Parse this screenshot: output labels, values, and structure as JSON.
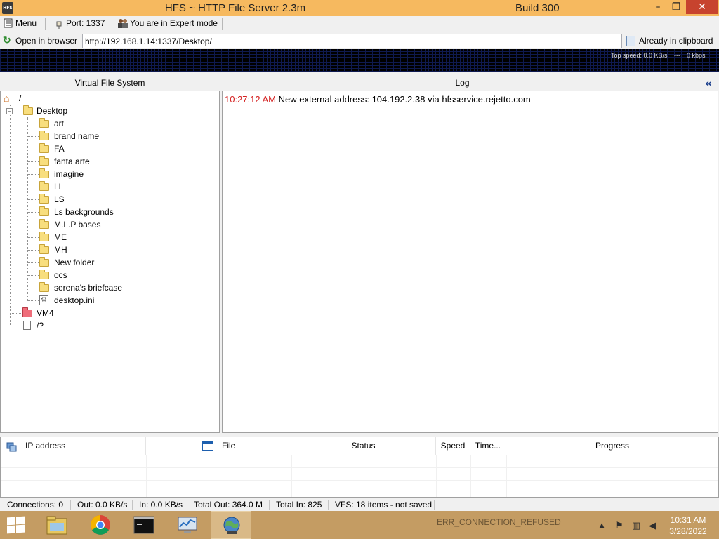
{
  "window": {
    "title": "HFS ~ HTTP File Server 2.3m",
    "build": "Build 300",
    "app_icon_text": "HFS",
    "minimize_glyph": "–",
    "maximize_glyph": "❐",
    "close_glyph": "✕"
  },
  "toolbar": {
    "menu": "Menu",
    "port": "Port: 1337",
    "mode": "You are in Expert mode"
  },
  "urlbar": {
    "open_browser": "Open in browser",
    "url": "http://192.168.1.14:1337/Desktop/",
    "clipboard": "Already in clipboard"
  },
  "graph": {
    "top_speed": "Top speed: 0.0 KB/s",
    "separator": "---",
    "kbps": "0 kbps"
  },
  "vfs": {
    "title": "Virtual File System",
    "root": "/",
    "desktop": {
      "label": "Desktop",
      "children": [
        {
          "label": "art",
          "type": "folder"
        },
        {
          "label": "brand name",
          "type": "folder"
        },
        {
          "label": "FA",
          "type": "folder"
        },
        {
          "label": "fanta arte",
          "type": "folder"
        },
        {
          "label": "imagine",
          "type": "folder"
        },
        {
          "label": "LL",
          "type": "folder"
        },
        {
          "label": "LS",
          "type": "folder"
        },
        {
          "label": "Ls backgrounds",
          "type": "folder"
        },
        {
          "label": "M.L.P bases",
          "type": "folder"
        },
        {
          "label": "ME",
          "type": "folder"
        },
        {
          "label": "MH",
          "type": "folder"
        },
        {
          "label": "New folder",
          "type": "folder"
        },
        {
          "label": "ocs",
          "type": "folder"
        },
        {
          "label": "serena's briefcase",
          "type": "folder"
        },
        {
          "label": "desktop.ini",
          "type": "file"
        }
      ]
    },
    "vm4": "VM4",
    "unknown": "/?"
  },
  "log": {
    "title": "Log",
    "entries": [
      {
        "time": "10:27:12 AM",
        "message": "New external address: 104.192.2.38 via hfsservice.rejetto.com"
      }
    ]
  },
  "connections": {
    "columns": [
      "IP address",
      "File",
      "Status",
      "Speed",
      "Time...",
      "Progress"
    ]
  },
  "status": {
    "connections": "Connections: 0",
    "out": "Out: 0.0 KB/s",
    "in": "In: 0.0 KB/s",
    "total_out": "Total Out: 364.0 M",
    "total_in": "Total In: 825",
    "vfs": "VFS: 18 items - not saved"
  },
  "taskbar": {
    "notification": "ERR_CONNECTION_REFUSED",
    "time": "10:31 AM",
    "date": "3/28/2022"
  },
  "colors": {
    "titlebar": "#f6b95f",
    "taskbar": "#c49c63",
    "log_time": "#d42020"
  }
}
